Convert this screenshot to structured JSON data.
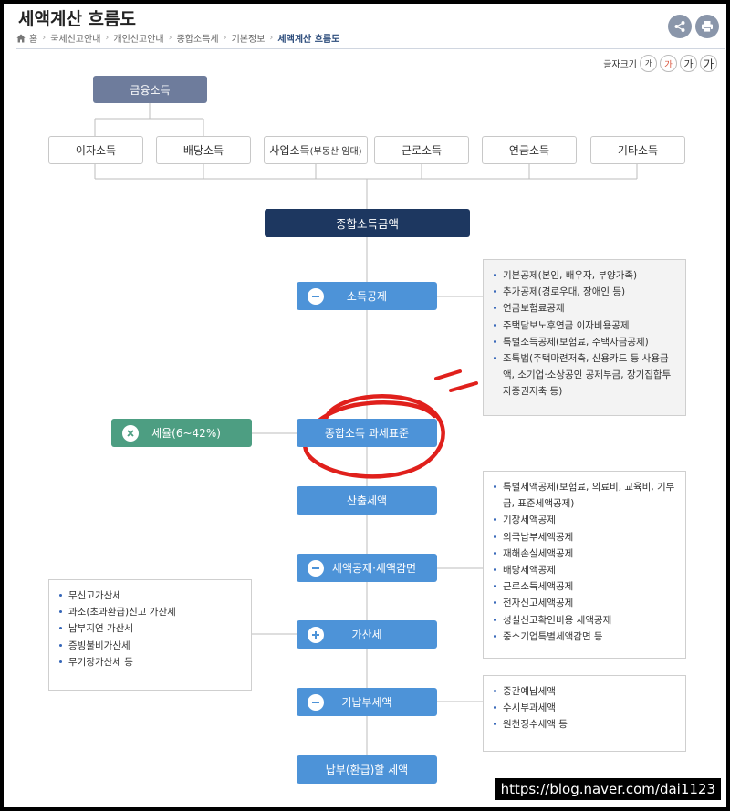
{
  "header": {
    "title": "세액계산 흐름도",
    "breadcrumb": [
      "홈",
      "국세신고안내",
      "개인신고안내",
      "종합소득세",
      "기본정보",
      "세액계산 흐름도"
    ],
    "font_size_label": "글자크기",
    "font_size_buttons": [
      "가",
      "가",
      "가",
      "가"
    ]
  },
  "diagram": {
    "financial_income": "금융소득",
    "income_types": [
      "이자소득",
      "배당소득",
      "사업소득",
      "근로소득",
      "연금소득",
      "기타소득"
    ],
    "business_income_sub": "(부동산 임대)",
    "total_income": "종합소득금액",
    "steps": [
      "소득공제",
      "종합소득 과세표준",
      "산출세액",
      "세액공제·세액감면",
      "가산세",
      "기납부세액",
      "납부(환급)할 세액"
    ],
    "tax_rate": "세율(6~42%)",
    "notes": {
      "deductions": [
        "기본공제(본인, 배우자, 부양가족)",
        "추가공제(경로우대, 장애인 등)",
        "연금보험료공제",
        "주택담보노후연금 이자비용공제",
        "특별소득공제(보험료, 주택자금공제)",
        "조특법(주택마련저축, 신용카드 등 사용금액, 소기업·소상공인 공제부금, 장기집합투자증권저축 등)"
      ],
      "credits": [
        "특별세액공제(보험료, 의료비, 교육비, 기부금, 표준세액공제)",
        "기장세액공제",
        "외국납부세액공제",
        "재해손실세액공제",
        "배당세액공제",
        "근로소득세액공제",
        "전자신고세액공제",
        "성실신고확인비용 세액공제",
        "중소기업특별세액감면 등"
      ],
      "penalties": [
        "무신고가산세",
        "과소(초과환급)신고 가산세",
        "납부지연 가산세",
        "증빙불비가산세",
        "무기장가산세 등"
      ],
      "prepaid": [
        "중간예납세액",
        "수시부과세액",
        "원천징수세액 등"
      ]
    }
  },
  "watermark": "https://blog.naver.com/dai1123",
  "colors": {
    "navy": "#1d3760",
    "blue": "#4d93d8",
    "green": "#4d9e82",
    "slate": "#6e7c9c",
    "annotation_red": "#e0201c"
  }
}
